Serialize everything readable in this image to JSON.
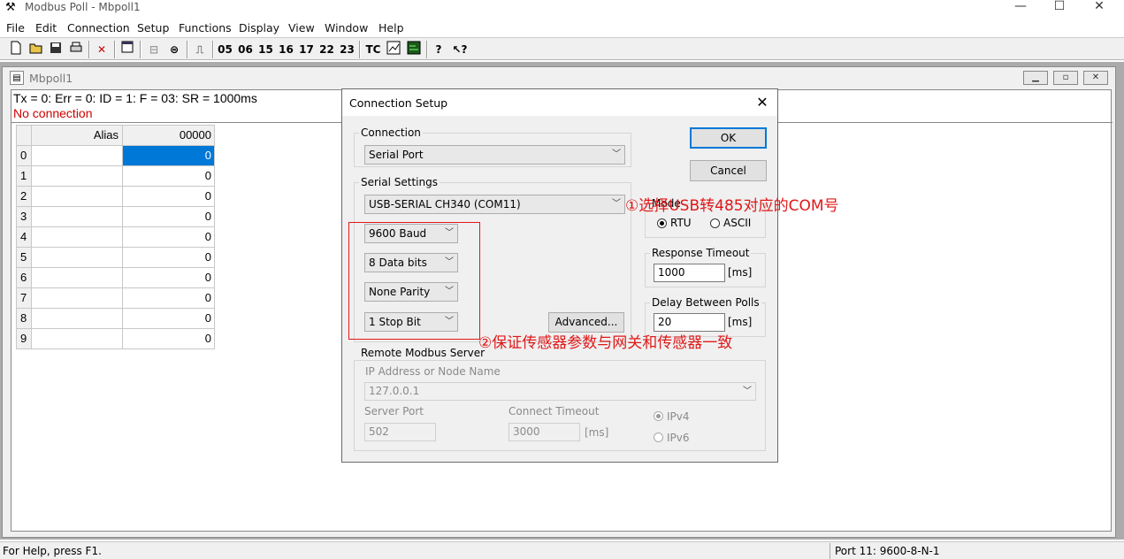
{
  "app": {
    "title": "Modbus Poll - Mbpoll1",
    "window_controls": [
      "—",
      "☐",
      "✕"
    ]
  },
  "menu": [
    "File",
    "Edit",
    "Connection",
    "Setup",
    "Functions",
    "Display",
    "View",
    "Window",
    "Help"
  ],
  "toolbar": {
    "function_codes": [
      "05",
      "06",
      "15",
      "16",
      "17",
      "22",
      "23"
    ],
    "tc_label": "TC",
    "icons": [
      "new-icon",
      "open-icon",
      "save-icon",
      "print-icon",
      "delete-icon",
      "window-icon",
      "connect-icon",
      "disconnect-icon",
      "pulse-icon",
      "tc-icon",
      "chart-icon",
      "monitor-icon",
      "help-icon",
      "context-help-icon"
    ]
  },
  "child": {
    "title": "Mbpoll1",
    "status_line": "Tx = 0: Err = 0: ID = 1: F = 03: SR = 1000ms",
    "no_connection": "No connection",
    "grid": {
      "alias_header": "Alias",
      "value_header": "00000",
      "rows": [
        {
          "index": "0",
          "alias": "",
          "value": "0"
        },
        {
          "index": "1",
          "alias": "",
          "value": "0"
        },
        {
          "index": "2",
          "alias": "",
          "value": "0"
        },
        {
          "index": "3",
          "alias": "",
          "value": "0"
        },
        {
          "index": "4",
          "alias": "",
          "value": "0"
        },
        {
          "index": "5",
          "alias": "",
          "value": "0"
        },
        {
          "index": "6",
          "alias": "",
          "value": "0"
        },
        {
          "index": "7",
          "alias": "",
          "value": "0"
        },
        {
          "index": "8",
          "alias": "",
          "value": "0"
        },
        {
          "index": "9",
          "alias": "",
          "value": "0"
        }
      ]
    }
  },
  "dialog": {
    "title": "Connection Setup",
    "connection_group": "Connection",
    "connection_value": "Serial Port",
    "serial_group": "Serial Settings",
    "port_value": "USB-SERIAL CH340 (COM11)",
    "baud_value": "9600 Baud",
    "databits_value": "8 Data bits",
    "parity_value": "None Parity",
    "stopbit_value": "1 Stop Bit",
    "advanced_label": "Advanced...",
    "ok_label": "OK",
    "cancel_label": "Cancel",
    "mode_group": "Mode",
    "mode_rtu": "RTU",
    "mode_ascii": "ASCII",
    "response_timeout_label": "Response Timeout",
    "response_timeout_value": "1000",
    "ms_unit": "[ms]",
    "delay_label": "Delay Between Polls",
    "delay_value": "20",
    "remote_group": "Remote Modbus Server",
    "ip_label": "IP Address or Node Name",
    "ip_value": "127.0.0.1",
    "server_port_label": "Server Port",
    "server_port_value": "502",
    "connect_timeout_label": "Connect Timeout",
    "connect_timeout_value": "3000",
    "ipv4_label": "IPv4",
    "ipv6_label": "IPv6"
  },
  "annotations": {
    "note1": "①选择USB转485对应的COM号",
    "note2": "②保证传感器参数与网关和传感器一致",
    "color": "#e01818"
  },
  "statusbar": {
    "help": "For Help, press F1.",
    "port": "Port 11: 9600-8-N-1"
  }
}
